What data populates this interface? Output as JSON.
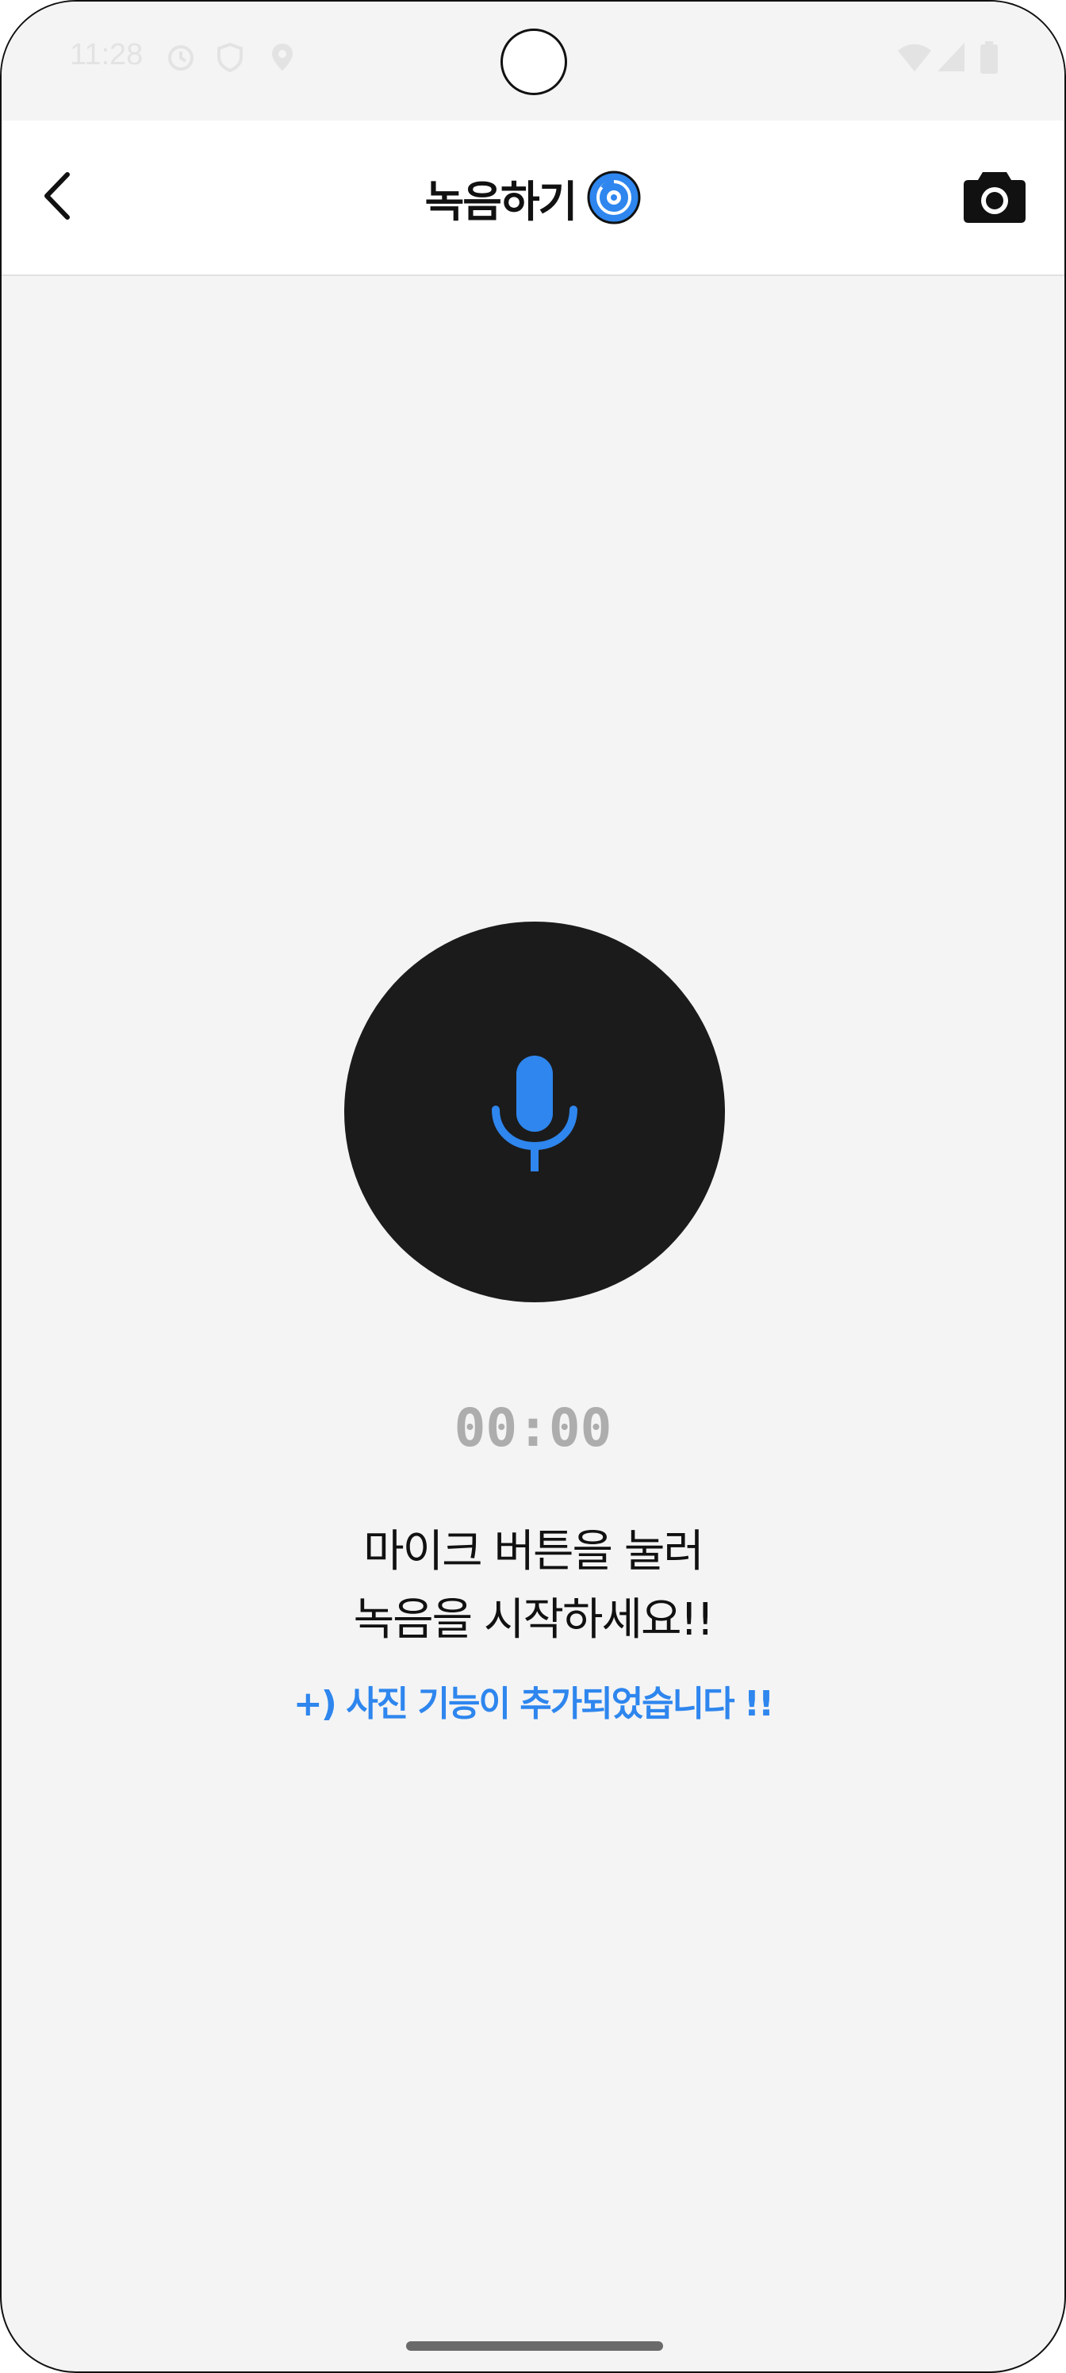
{
  "status_bar": {
    "time": "11:28",
    "icons": [
      "alarm-icon",
      "shield-icon",
      "location-icon",
      "wifi-icon",
      "signal-icon",
      "battery-icon"
    ]
  },
  "app_bar": {
    "title": "녹음하기",
    "back_icon": "chevron-left-icon",
    "title_badge_icon": "record-disc-icon",
    "action_icon": "camera-icon"
  },
  "recorder": {
    "mic_icon": "microphone-icon",
    "timer": "00:00",
    "instruction_line1": "마이크 버튼을 눌러",
    "instruction_line2": "녹음을 시작하세요!!",
    "notice": "+) 사진 기능이 추가되었습니다 !!"
  },
  "colors": {
    "accent": "#2e86ee",
    "mic_button": "#1b1b1b",
    "background": "#f4f4f4",
    "timer": "#adadad"
  }
}
